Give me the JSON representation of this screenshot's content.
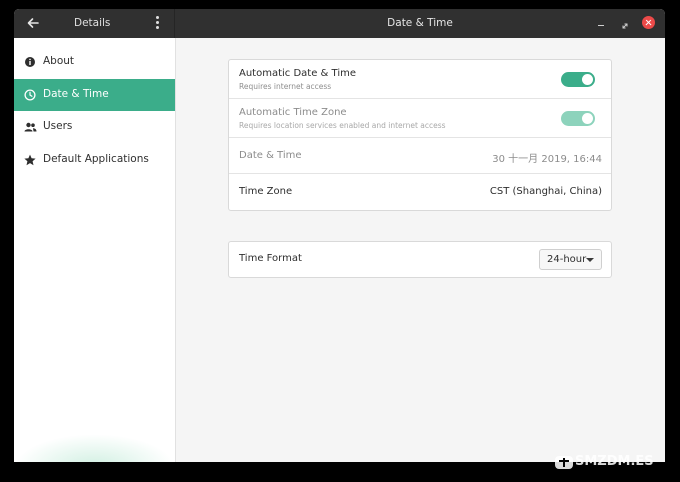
{
  "titlebar": {
    "left_title": "Details",
    "window_title": "Date & Time"
  },
  "sidebar": {
    "items": [
      {
        "label": "About",
        "icon": "info-icon"
      },
      {
        "label": "Date & Time",
        "icon": "clock-icon",
        "active": true
      },
      {
        "label": "Users",
        "icon": "users-icon"
      },
      {
        "label": "Default Applications",
        "icon": "star-icon"
      }
    ]
  },
  "datetime": {
    "auto_date_time": {
      "title": "Automatic Date & Time",
      "subtitle": "Requires internet access",
      "enabled": true
    },
    "auto_time_zone": {
      "title": "Automatic Time Zone",
      "subtitle": "Requires location services enabled and internet access",
      "enabled": true
    },
    "date_time": {
      "title": "Date & Time",
      "value": "30 十一月 2019, 16:44"
    },
    "time_zone": {
      "title": "Time Zone",
      "value": "CST (Shanghai, China)"
    }
  },
  "time_format": {
    "title": "Time Format",
    "selected": "24-hour"
  },
  "watermark": {
    "text": "SMZDM.ES"
  },
  "colors": {
    "accent": "#3bad8a",
    "titlebar": "#303030",
    "close": "#ec4a49"
  }
}
